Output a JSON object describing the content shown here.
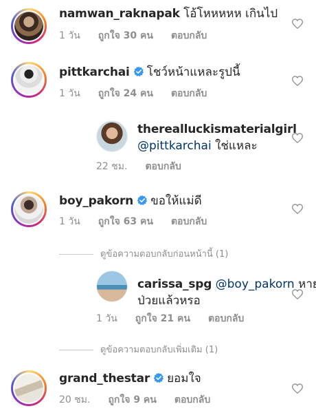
{
  "comments": [
    {
      "username": "namwan_raknapak",
      "text": "โอ้โหหหหห เกินไป",
      "time": "1 วัน",
      "likes": "ถูกใจ 30 คน",
      "reply": "ตอบกลับ"
    },
    {
      "username": "pittkarchai",
      "verified": true,
      "text": "โชว์หน้าแหละรูปนี้",
      "time": "1 วัน",
      "likes": "ถูกใจ 24 คน",
      "reply": "ตอบกลับ"
    },
    {
      "username": "therealluckismaterialgirl",
      "mention": "@pittkarchai",
      "text": "ใช่แหละ",
      "time": "22 ชม.",
      "reply": "ตอบกลับ"
    },
    {
      "username": "boy_pakorn",
      "verified": true,
      "text": "ขอให้แม่ดี",
      "time": "1 วัน",
      "likes": "ถูกใจ 63 คน",
      "reply": "ตอบกลับ"
    },
    {
      "username": "carissa_spg",
      "mention": "@boy_pakorn",
      "text_line1": "หาย",
      "text_line2": "ป่วยแล้วหรอ",
      "time": "1 วัน",
      "likes": "ถูกใจ 21 คน",
      "reply": "ตอบกลับ"
    },
    {
      "username": "grand_thestar",
      "verified": true,
      "text": "ยอมใจ",
      "time": "20 ชม.",
      "likes": "ถูกใจ 9 คน",
      "reply": "ตอบกลับ"
    }
  ],
  "view_previous_replies": "ดูข้อความตอบกลับก่อนหน้านี้ (1)",
  "view_more_replies": "ดูข้อความตอบกลับเพิ่มเติม (1)",
  "colors": {
    "verified_blue": "#3897f0",
    "meta_gray": "#8e8e8e",
    "mention_blue": "#003569"
  },
  "icons": {
    "like": "heart-outline-icon",
    "verified": "verified-badge-icon"
  }
}
